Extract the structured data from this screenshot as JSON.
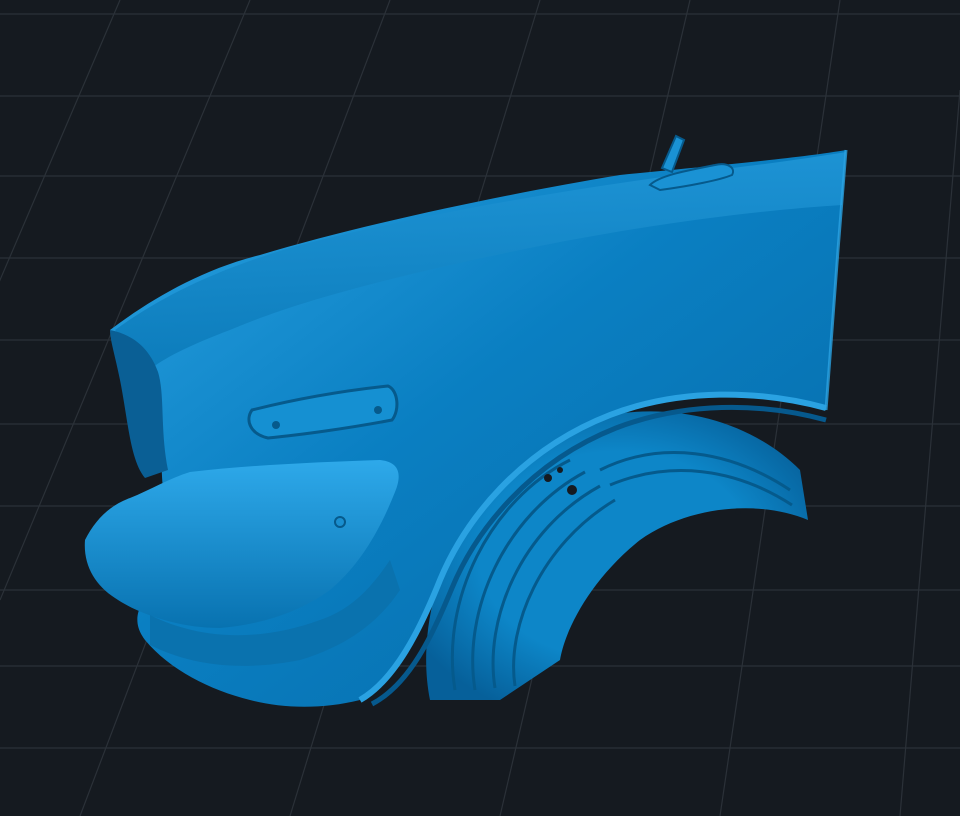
{
  "viewport": {
    "background": "#151a20",
    "grid_color": "#2b3138",
    "model_color": "#0a7fc2",
    "model_highlight": "#2fa6e6",
    "model_shadow": "#055a8c"
  },
  "model": {
    "icon": "car-fender-3d-scan"
  }
}
